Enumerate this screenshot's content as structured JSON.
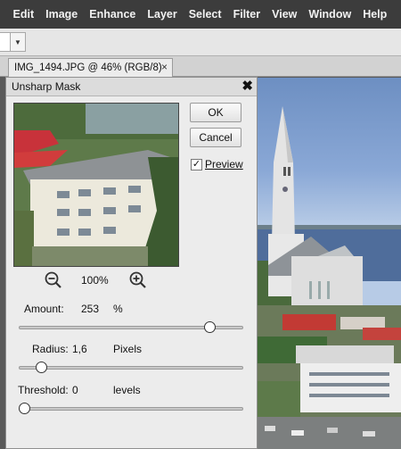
{
  "menubar": {
    "items": [
      "Edit",
      "Image",
      "Enhance",
      "Layer",
      "Select",
      "Filter",
      "View",
      "Window",
      "Help"
    ]
  },
  "tab": {
    "title": "IMG_1494.JPG @ 46% (RGB/8)",
    "close": "×"
  },
  "dialog": {
    "title": "Unsharp Mask",
    "close": "✖",
    "ok_label": "OK",
    "cancel_label": "Cancel",
    "preview_label": "Preview",
    "preview_checked": true,
    "zoom_value": "100%",
    "amount": {
      "label": "Amount:",
      "value": "253",
      "unit": "%",
      "slider_fraction": 0.87
    },
    "radius": {
      "label": "Radius:",
      "value": "1,6",
      "unit": "Pixels",
      "slider_fraction": 0.08
    },
    "threshold": {
      "label": "Threshold:",
      "value": "0",
      "unit": "levels",
      "slider_fraction": 0.0
    }
  }
}
